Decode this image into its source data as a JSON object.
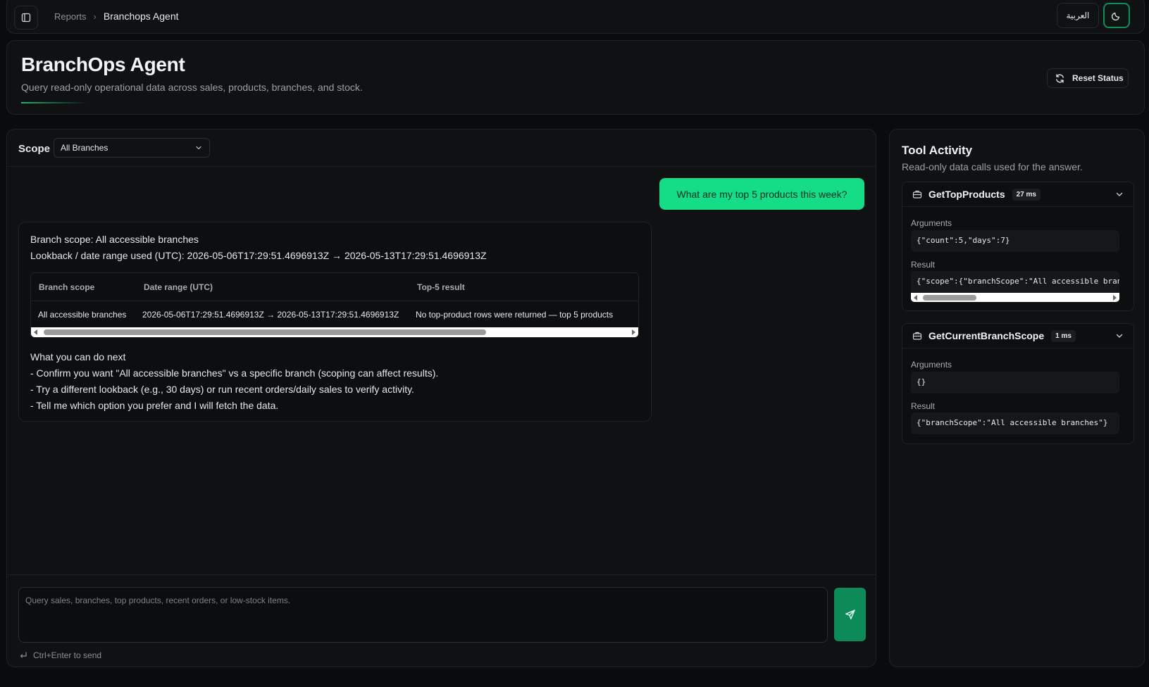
{
  "topbar": {
    "breadcrumb_parent": "Reports",
    "breadcrumb_current": "Branchops Agent",
    "language_label": "العربية"
  },
  "header": {
    "title": "BranchOps Agent",
    "subtitle": "Query read-only operational data across sales, products, branches, and stock.",
    "reset_label": "Reset Status"
  },
  "chat": {
    "scope_label": "Scope",
    "scope_value": "All Branches",
    "user_message": "What are my top 5 products this week?",
    "assistant": {
      "line1": "Branch scope: All accessible branches",
      "line2": "Lookback / date range used (UTC): 2026-05-06T17:29:51.4696913Z → 2026-05-13T17:29:51.4696913Z",
      "table": {
        "headers": [
          "Branch scope",
          "Date range (UTC)",
          "Top-5 result"
        ],
        "rows": [
          [
            "All accessible branches",
            "2026-05-06T17:29:51.4696913Z → 2026-05-13T17:29:51.4696913Z",
            "No top-product rows were returned — top 5 products"
          ]
        ]
      },
      "next_heading": "What you can do next",
      "next_items": [
        "- Confirm you want \"All accessible branches\" vs a specific branch (scoping can affect results).",
        "- Try a different lookback (e.g., 30 days) or run recent orders/daily sales to verify activity.",
        "- Tell me which option you prefer and I will fetch the data."
      ]
    },
    "composer_placeholder": "Query sales, branches, top products, recent orders, or low-stock items.",
    "hint": "Ctrl+Enter to send"
  },
  "tools": {
    "title": "Tool Activity",
    "subtitle": "Read-only data calls used for the answer.",
    "arguments_label": "Arguments",
    "result_label": "Result",
    "calls": [
      {
        "name": "GetTopProducts",
        "duration": "27 ms",
        "arguments": "{\"count\":5,\"days\":7}",
        "result": "{\"scope\":{\"branchScope\":\"All accessible branches\"}}"
      },
      {
        "name": "GetCurrentBranchScope",
        "duration": "1 ms",
        "arguments": "{}",
        "result": "{\"branchScope\":\"All accessible branches\"}"
      }
    ]
  },
  "colors": {
    "accent": "#14dc87",
    "accent_dark": "#0c8b59",
    "background": "#0a0b0d",
    "panel": "#0f1113"
  },
  "icons": {
    "sidebar_toggle": "sidebar-icon",
    "theme": "moon-icon",
    "reset": "refresh-icon",
    "send": "send-icon",
    "tool": "toolbox-icon",
    "expand": "chevron-down-icon",
    "enter": "enter-key-icon"
  }
}
